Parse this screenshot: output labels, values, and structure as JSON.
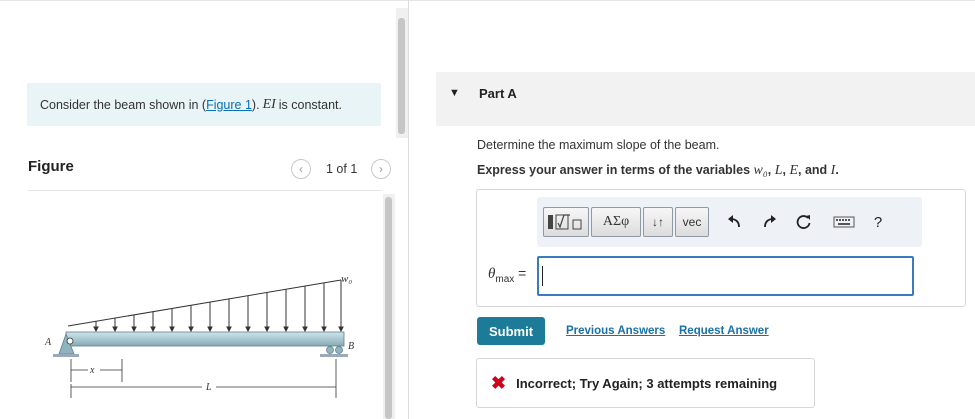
{
  "intro": {
    "text_before": "Consider the beam shown in (",
    "figure_link": "Figure 1",
    "text_after": ").",
    "math": "EI",
    "text_end": "is constant."
  },
  "figure": {
    "title": "Figure",
    "pager_text": "1 of 1",
    "prev_icon": "chevron-left-icon",
    "next_icon": "chevron-right-icon",
    "labels": {
      "load": "w₀",
      "left_support": "A",
      "right_support": "B",
      "x": "x",
      "length": "L"
    }
  },
  "part": {
    "title": "Part A",
    "question": "Determine the maximum slope of the beam.",
    "instruction_prefix": "Express your answer in terms of the variables",
    "vars": [
      "w₀",
      "L",
      "E"
    ],
    "instruction_and": "and",
    "last_var": "I",
    "period": "."
  },
  "toolbar": {
    "templates_icon": "templates-icon",
    "greek_label": "ΑΣφ",
    "sort_label": "↓↑",
    "vec_label": "vec",
    "undo_icon": "undo-icon",
    "redo_icon": "redo-icon",
    "reset_icon": "reset-icon",
    "keyboard_icon": "keyboard-icon",
    "help_label": "?"
  },
  "answer": {
    "var": "θ",
    "sub": "max",
    "equals": "=",
    "value": ""
  },
  "actions": {
    "submit": "Submit",
    "previous": "Previous Answers",
    "request": "Request Answer"
  },
  "feedback": {
    "icon": "x-icon",
    "text": "Incorrect; Try Again; 3 attempts remaining"
  },
  "colors": {
    "accent": "#1c7b99",
    "link": "#1a70a8",
    "error": "#d0021b",
    "intro_bg": "#e8f4f6"
  }
}
